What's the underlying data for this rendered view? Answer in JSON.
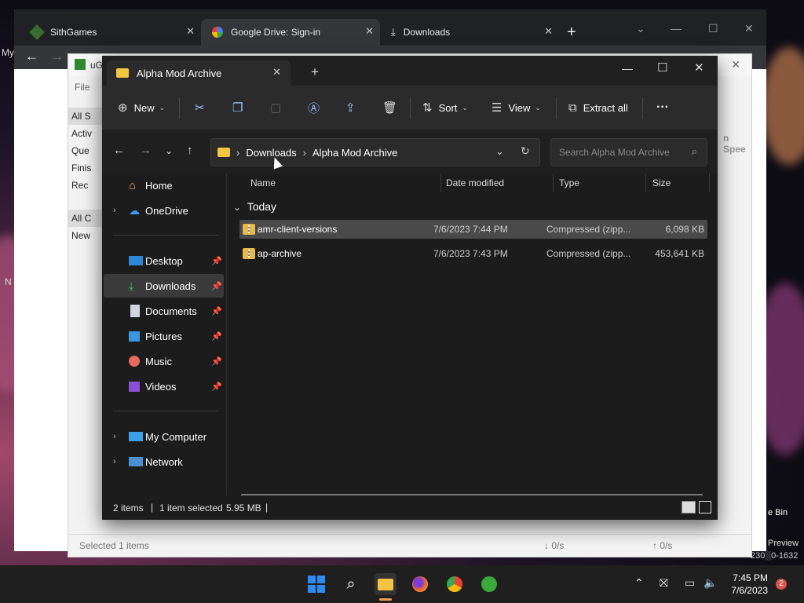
{
  "browser": {
    "tabs": [
      {
        "label": "SithGames"
      },
      {
        "label": "Google Drive: Sign-in"
      },
      {
        "label": "Downloads"
      }
    ],
    "new_tab": "+",
    "desktop_left_text": "My",
    "desktop_left_text2": "N"
  },
  "uget": {
    "menu_file": "File",
    "title_prefix": "uG",
    "sidebar": [
      "All S",
      "Activ",
      "Que",
      "Finis",
      "Rec",
      "All C",
      "New"
    ],
    "status_selected": "Selected 1 items",
    "status_down": "↓ 0/s",
    "status_up": "↑ 0/s",
    "speed_partial": "n Spee"
  },
  "desktop": {
    "recycle_partial": "e Bin",
    "preview_partial": "Preview",
    "build_partial": "230░0-1632"
  },
  "explorer": {
    "tab_title": "Alpha Mod Archive",
    "toolbar": {
      "new": "New",
      "sort": "Sort",
      "view": "View",
      "extract_all": "Extract all",
      "more": "···"
    },
    "breadcrumb": [
      "Downloads",
      "Alpha Mod Archive"
    ],
    "search_placeholder": "Search Alpha Mod Archive",
    "nav": {
      "home": "Home",
      "onedrive": "OneDrive",
      "desktop": "Desktop",
      "downloads": "Downloads",
      "documents": "Documents",
      "pictures": "Pictures",
      "music": "Music",
      "videos": "Videos",
      "mycomputer": "My Computer",
      "network": "Network"
    },
    "columns": {
      "name": "Name",
      "date": "Date modified",
      "type": "Type",
      "size": "Size"
    },
    "group": "Today",
    "files": [
      {
        "name": "amr-client-versions",
        "date": "7/6/2023 7:44 PM",
        "type": "Compressed (zipp...",
        "size": "6,098 KB"
      },
      {
        "name": "ap-archive",
        "date": "7/6/2023 7:43 PM",
        "type": "Compressed (zipp...",
        "size": "453,641 KB"
      }
    ],
    "status": {
      "items": "2 items",
      "selected": "1 item selected",
      "size": "5.95 MB"
    }
  },
  "taskbar": {
    "time": "7:45 PM",
    "date": "7/6/2023",
    "notifications": "2"
  }
}
